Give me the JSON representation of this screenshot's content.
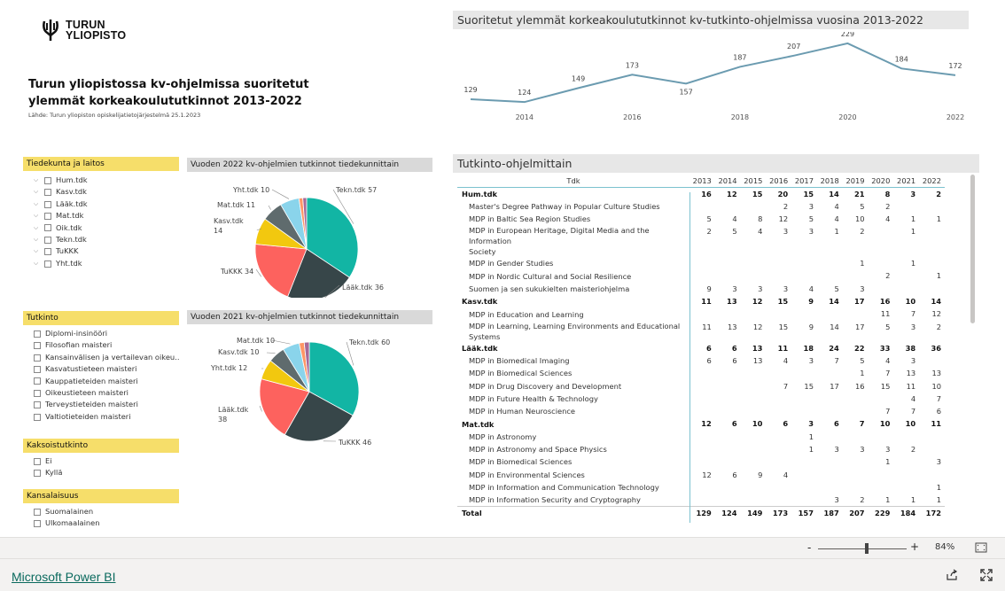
{
  "logo": {
    "line1": "TURUN",
    "line2": "YLIOPISTO"
  },
  "title": "Turun yliopistossa kv-ohjelmissa suoritetut ylemmät korkeakoulututkinnot 2013-2022",
  "source": "Lähde: Turun  yliopiston opiskelijatietojärjestelmä 25.1.2023",
  "slicers": {
    "faculty": {
      "header": "Tiedekunta ja laitos",
      "items": [
        "Hum.tdk",
        "Kasv.tdk",
        "Lääk.tdk",
        "Mat.tdk",
        "Oik.tdk",
        "Tekn.tdk",
        "TuKKK",
        "Yht.tdk"
      ]
    },
    "degree": {
      "header": "Tutkinto",
      "items": [
        "Diplomi-insinööri",
        "Filosofian maisteri",
        "Kansainvälisen ja vertailevan oikeu...",
        "Kasvatustieteen maisteri",
        "Kauppatieteiden maisteri",
        "Oikeustieteen maisteri",
        "Terveystieteiden maisteri",
        "Valtiotieteiden maisteri"
      ]
    },
    "double": {
      "header": "Kaksoistutkinto",
      "items": [
        "Ei",
        "Kyllä"
      ]
    },
    "citizen": {
      "header": "Kansalaisuus",
      "items": [
        "Suomalainen",
        "Ulkomaalainen"
      ]
    }
  },
  "line_chart": {
    "title": "Suoritetut ylemmät korkeakoulututkinnot kv-tutkinto-ohjelmissa vuosina 2013-2022",
    "chart_data": {
      "type": "line",
      "x": [
        2013,
        2014,
        2015,
        2016,
        2017,
        2018,
        2019,
        2020,
        2021,
        2022
      ],
      "values": [
        129,
        124,
        149,
        173,
        157,
        187,
        207,
        229,
        184,
        172
      ],
      "xticks": [
        "2014",
        "2016",
        "2018",
        "2020",
        "2022"
      ],
      "color": "#6b9bb0"
    }
  },
  "pie2022": {
    "title": "Vuoden 2022 kv-ohjelmien tutkinnot tiedekunnittain",
    "chart_data": {
      "type": "pie",
      "labels": [
        "Tekn.tdk",
        "Lääk.tdk",
        "TuKKK",
        "Kasv.tdk",
        "Mat.tdk",
        "Yht.tdk",
        "Hum.tdk",
        "Oik.tdk"
      ],
      "values": [
        57,
        36,
        34,
        14,
        11,
        10,
        2,
        2
      ],
      "display": [
        "Tekn.tdk 57",
        "Lääk.tdk 36",
        "TuKKK 34",
        "Kasv.tdk\n14",
        "Mat.tdk 11",
        "Yht.tdk 10",
        "",
        ""
      ]
    }
  },
  "pie2021": {
    "title": "Vuoden 2021 kv-ohjelmien tutkinnot tiedekunnittain",
    "chart_data": {
      "type": "pie",
      "labels": [
        "Tekn.tdk",
        "TuKKK",
        "Lääk.tdk",
        "Yht.tdk",
        "Kasv.tdk",
        "Mat.tdk",
        "Hum.tdk",
        "Oik.tdk"
      ],
      "values": [
        60,
        46,
        38,
        12,
        10,
        10,
        3,
        3
      ],
      "display": [
        "Tekn.tdk 60",
        "TuKKK 46",
        "Lääk.tdk\n38",
        "Yht.tdk 12",
        "Kasv.tdk 10",
        "Mat.tdk 10",
        "",
        ""
      ]
    }
  },
  "pie_colors": [
    "#12b5a4",
    "#374649",
    "#fd625e",
    "#f2c80f",
    "#5f6b6d",
    "#8ad4eb",
    "#fe9666",
    "#a66999"
  ],
  "table": {
    "title": "Tutkinto-ohjelmittain",
    "header_label": "Tdk",
    "years": [
      "2013",
      "2014",
      "2015",
      "2016",
      "2017",
      "2018",
      "2019",
      "2020",
      "2021",
      "2022"
    ],
    "rows": [
      {
        "b": true,
        "name": "Hum.tdk",
        "v": [
          "16",
          "12",
          "15",
          "20",
          "15",
          "14",
          "21",
          "8",
          "3",
          "2"
        ]
      },
      {
        "name": "Master's Degree Pathway in Popular Culture Studies",
        "v": [
          "",
          "",
          "",
          "2",
          "3",
          "4",
          "5",
          "2",
          "",
          ""
        ]
      },
      {
        "name": "MDP in Baltic Sea Region Studies",
        "v": [
          "5",
          "4",
          "8",
          "12",
          "5",
          "4",
          "10",
          "4",
          "1",
          "1"
        ]
      },
      {
        "name": "MDP in European Heritage, Digital Media and the Information",
        "name2": "Society",
        "v": [
          "2",
          "5",
          "4",
          "3",
          "3",
          "1",
          "2",
          "",
          "1",
          ""
        ]
      },
      {
        "name": "MDP in Gender Studies",
        "v": [
          "",
          "",
          "",
          "",
          "",
          "",
          "1",
          "",
          "1",
          ""
        ]
      },
      {
        "name": "MDP in Nordic Cultural and Social Resilience",
        "v": [
          "",
          "",
          "",
          "",
          "",
          "",
          "",
          "2",
          "",
          "1"
        ]
      },
      {
        "name": "Suomen ja sen sukukielten maisteriohjelma",
        "v": [
          "9",
          "3",
          "3",
          "3",
          "4",
          "5",
          "3",
          "",
          "",
          ""
        ]
      },
      {
        "b": true,
        "name": "Kasv.tdk",
        "v": [
          "11",
          "13",
          "12",
          "15",
          "9",
          "14",
          "17",
          "16",
          "10",
          "14"
        ]
      },
      {
        "name": "MDP in Education and Learning",
        "v": [
          "",
          "",
          "",
          "",
          "",
          "",
          "",
          "11",
          "7",
          "12"
        ]
      },
      {
        "name": "MDP in Learning, Learning Environments and Educational",
        "name2": "Systems",
        "v": [
          "11",
          "13",
          "12",
          "15",
          "9",
          "14",
          "17",
          "5",
          "3",
          "2"
        ]
      },
      {
        "b": true,
        "name": "Lääk.tdk",
        "v": [
          "6",
          "6",
          "13",
          "11",
          "18",
          "24",
          "22",
          "33",
          "38",
          "36"
        ]
      },
      {
        "name": "MDP in Biomedical Imaging",
        "v": [
          "6",
          "6",
          "13",
          "4",
          "3",
          "7",
          "5",
          "4",
          "3",
          ""
        ]
      },
      {
        "name": "MDP in Biomedical Sciences",
        "v": [
          "",
          "",
          "",
          "",
          "",
          "",
          "1",
          "7",
          "13",
          "13"
        ]
      },
      {
        "name": "MDP in Drug Discovery and Development",
        "v": [
          "",
          "",
          "",
          "7",
          "15",
          "17",
          "16",
          "15",
          "11",
          "10"
        ]
      },
      {
        "name": "MDP in Future Health & Technology",
        "v": [
          "",
          "",
          "",
          "",
          "",
          "",
          "",
          "",
          "4",
          "7"
        ]
      },
      {
        "name": "MDP in Human Neuroscience",
        "v": [
          "",
          "",
          "",
          "",
          "",
          "",
          "",
          "7",
          "7",
          "6"
        ]
      },
      {
        "b": true,
        "name": "Mat.tdk",
        "v": [
          "12",
          "6",
          "10",
          "6",
          "3",
          "6",
          "7",
          "10",
          "10",
          "11"
        ]
      },
      {
        "name": "MDP in Astronomy",
        "v": [
          "",
          "",
          "",
          "",
          "1",
          "",
          "",
          "",
          "",
          ""
        ]
      },
      {
        "name": "MDP in Astronomy and Space Physics",
        "v": [
          "",
          "",
          "",
          "",
          "1",
          "3",
          "3",
          "3",
          "2",
          ""
        ]
      },
      {
        "name": "MDP in Biomedical Sciences",
        "v": [
          "",
          "",
          "",
          "",
          "",
          "",
          "",
          "1",
          "",
          "3"
        ]
      },
      {
        "name": "MDP in Environmental Sciences",
        "v": [
          "12",
          "6",
          "9",
          "4",
          "",
          "",
          "",
          "",
          "",
          ""
        ]
      },
      {
        "name": "MDP in Information and Communication Technology",
        "v": [
          "",
          "",
          "",
          "",
          "",
          "",
          "",
          "",
          "",
          "1"
        ]
      },
      {
        "name": "MDP in Information Security and Cryptography",
        "v": [
          "",
          "",
          "",
          "",
          "",
          "3",
          "2",
          "1",
          "1",
          "1"
        ]
      }
    ],
    "total": {
      "name": "Total",
      "v": [
        "129",
        "124",
        "149",
        "173",
        "157",
        "187",
        "207",
        "229",
        "184",
        "172"
      ]
    }
  },
  "zoom": {
    "minus": "-",
    "plus": "+",
    "level": "84%",
    "value": 0.55
  },
  "footer": {
    "link": "Microsoft Power BI"
  }
}
